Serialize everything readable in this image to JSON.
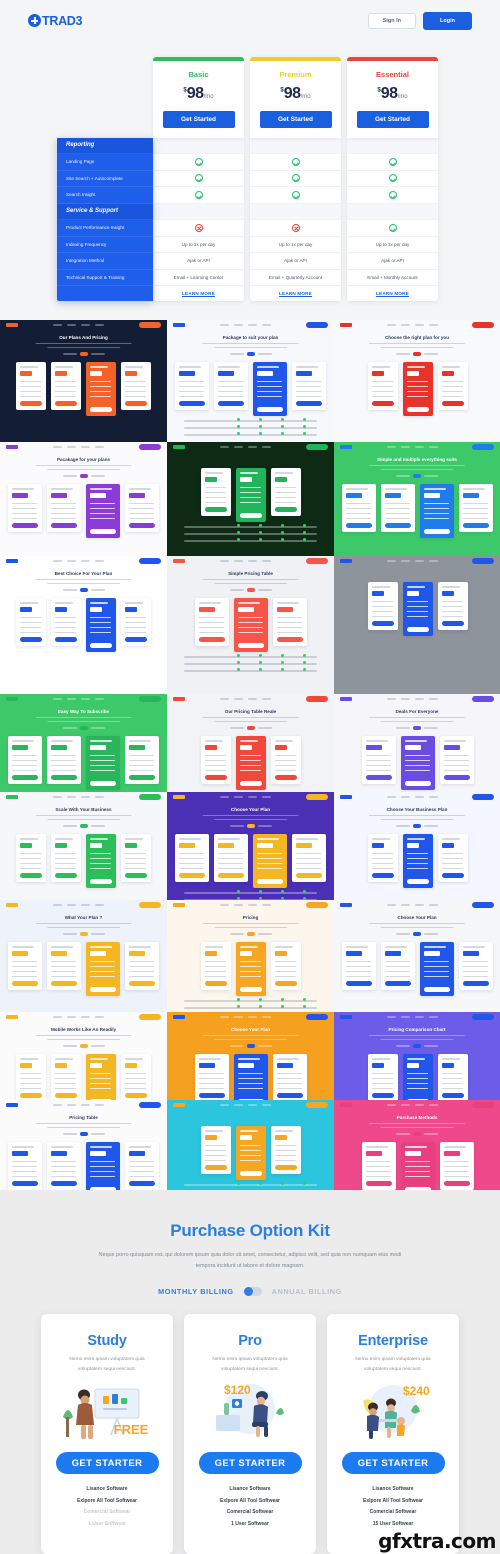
{
  "header": {
    "logo_text": "TRAD3",
    "sign_in": "Sign In",
    "login": "Login"
  },
  "pricing_table": {
    "plans": [
      {
        "name": "Basic",
        "color": "#2bbf5a",
        "currency": "$",
        "amount": "98",
        "per": "/mo",
        "cta": "Get Started"
      },
      {
        "name": "Premium",
        "color": "#f0cd2e",
        "currency": "$",
        "amount": "98",
        "per": "/mo",
        "cta": "Get Started"
      },
      {
        "name": "Essential",
        "color": "#e8453c",
        "currency": "$",
        "amount": "98",
        "per": "/mo",
        "cta": "Get Started"
      }
    ],
    "sections": [
      {
        "heading": "Reporting",
        "rows": [
          {
            "label": "Landing Page",
            "values": [
              "check",
              "check",
              "check"
            ]
          },
          {
            "label": "Site Search + Autocomplete",
            "values": [
              "check",
              "check",
              "check"
            ]
          },
          {
            "label": "Search Insight",
            "values": [
              "check",
              "check",
              "check"
            ]
          }
        ]
      },
      {
        "heading": "Service & Support",
        "rows": [
          {
            "label": "Product Performance Insight",
            "values": [
              "cross",
              "cross",
              "check"
            ]
          },
          {
            "label": "Indexing Frequency",
            "values": [
              "Up to 1x per day",
              "Up to 1x per day",
              "Up to 1x per day"
            ]
          },
          {
            "label": "Integration Method",
            "values": [
              "Ajak or API",
              "Ajak or API",
              "Ajak or API"
            ]
          },
          {
            "label": "Technical Support & Training",
            "values": [
              "Email + Learning Center",
              "Email + Quarterly Account",
              "Email + Monthly Account"
            ]
          }
        ]
      }
    ],
    "learn_more": "LEARN MORE"
  },
  "thumbnails": [
    {
      "id": "dark-plans",
      "title": "Our Plans And Pricing",
      "bg": "#131e36",
      "accent": "#f4622a"
    },
    {
      "id": "package-suit",
      "title": "Package to suit your plan",
      "bg": "#f7f8fb",
      "accent": "#2157e8"
    },
    {
      "id": "right-plan-red",
      "title": "Choose the right plan for you",
      "bg": "#f8f9fb",
      "accent": "#e8332a"
    },
    {
      "id": "package-purple",
      "title": "Pacakage for your plans",
      "bg": "#fbfbfd",
      "accent": "#8b3bd6"
    },
    {
      "id": "green-bokeh",
      "title": "",
      "bg": "#0e2a14",
      "accent": "#21b45a"
    },
    {
      "id": "simple-flexible",
      "title": "Simple and multiple everything suits",
      "bg": "#3dc96a",
      "accent": "#1f7ce8"
    },
    {
      "id": "best-choice",
      "title": "Best Choice For Your Plan",
      "bg": "#ffffff",
      "accent": "#2157e8"
    },
    {
      "id": "simple-pricing",
      "title": "Simple Pricing Table",
      "bg": "#f0f1f4",
      "accent": "#f8554a"
    },
    {
      "id": "photo-table",
      "title": "",
      "bg": "#8e949c",
      "accent": "#2157e8"
    },
    {
      "id": "green-swoosh",
      "title": "Easy Way To Subscribe",
      "bg": "#3dc96a",
      "accent": "#2ab55c"
    },
    {
      "id": "red-table",
      "title": "Our Pricing Table Reale",
      "bg": "#f2f3f6",
      "accent": "#f1483c"
    },
    {
      "id": "deals-everyone",
      "title": "Deals For Everyone",
      "bg": "#f6f6fa",
      "accent": "#6b4ce0"
    },
    {
      "id": "scale-business",
      "title": "Scale With Your Business",
      "bg": "#f6f7fa",
      "accent": "#2bbf5a"
    },
    {
      "id": "choose-plan-purple",
      "title": "Choose Your Plan",
      "bg": "#4b2fb5",
      "accent": "#f5b623"
    },
    {
      "id": "business-plan-blue",
      "title": "Choose Your Business Plan",
      "bg": "#f4f7ff",
      "accent": "#2157e8"
    },
    {
      "id": "whats-your-plan",
      "title": "What Your Plan ?",
      "bg": "#eef2fa",
      "accent": "#f5b623"
    },
    {
      "id": "pricing-orange",
      "title": "Pricing",
      "bg": "#fdf6ec",
      "accent": "#f5a623"
    },
    {
      "id": "choose-your-plan",
      "title": "Choose Your Plan",
      "bg": "#f6f7f9",
      "accent": "#2157e8"
    },
    {
      "id": "mobile-readily",
      "title": "Mobile Works Like An Readily",
      "bg": "#fbfbfc",
      "accent": "#f5b623"
    },
    {
      "id": "choose-plan-orange",
      "title": "Choose Your Plan",
      "bg": "#f6a01f",
      "accent": "#2157e8"
    },
    {
      "id": "comparison-chart",
      "title": "Pricing Comparison Chart",
      "bg": "#6c5ce8",
      "accent": "#2157e8"
    },
    {
      "id": "pricing-table-lt",
      "title": "Pricing Table",
      "bg": "#fbfbfc",
      "accent": "#2157e8"
    },
    {
      "id": "cyan-cards",
      "title": "",
      "bg": "#2bc6de",
      "accent": "#f5a623"
    },
    {
      "id": "purchase-methods",
      "title": "Purchase Methods",
      "bg": "#f0498b",
      "accent": "#e8407f"
    }
  ],
  "purchase": {
    "title": "Purchase Option Kit",
    "subtitle": "Neque porro quisquam est, qui dolorem ipsum quia dolor sit amet, consectetur, adipisci velit, sed quia non numquam eius modi tempora incidunt ut labore et dolore magnam.",
    "billing_monthly": "MONTHLY BILLING",
    "billing_annual": "ANNUAL BILLING",
    "cards": [
      {
        "name": "Study",
        "desc": "Nemo enim ipsam voluptatem quia voluptatem sequi nesciunt.",
        "price": "FREE",
        "cta": "GET STARTER",
        "features": [
          {
            "label": "Lisance Software",
            "enabled": true
          },
          {
            "label": "Exlpore All Tool Softwear",
            "enabled": true
          },
          {
            "label": "Comercial Softwear",
            "enabled": false
          },
          {
            "label": "1 User Softwear",
            "enabled": false
          }
        ]
      },
      {
        "name": "Pro",
        "desc": "Nemo enim ipsam voluptatem quia voluptatem sequi nesciunt.",
        "price": "$120",
        "cta": "GET STARTER",
        "features": [
          {
            "label": "Lisance Software",
            "enabled": true
          },
          {
            "label": "Exlpore All Tool Softwear",
            "enabled": true
          },
          {
            "label": "Comercial Softwear",
            "enabled": true
          },
          {
            "label": "1 User Softwear",
            "enabled": true
          }
        ]
      },
      {
        "name": "Enterprise",
        "desc": "Nemo enim ipsam voluptatem quia voluptatem sequi nesciunt.",
        "price": "$240",
        "cta": "GET STARTER",
        "features": [
          {
            "label": "Lisance Software",
            "enabled": true
          },
          {
            "label": "Exlpore All Tool Softwear",
            "enabled": true
          },
          {
            "label": "Comercial Softwear",
            "enabled": true
          },
          {
            "label": "15 User Softwear",
            "enabled": true
          }
        ]
      }
    ]
  },
  "watermark": "gfxtra.com"
}
